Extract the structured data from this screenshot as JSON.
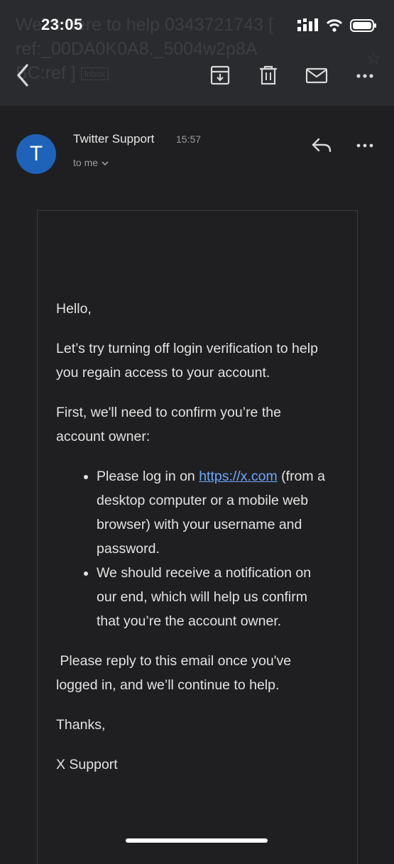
{
  "status_bar": {
    "time": "23:05"
  },
  "header": {
    "subject": "We're here to help 0343721743 [ ref:_00DA0K0A8._5004w2p8A",
    "subject_line2": "BC:ref ]",
    "label_chip": "Inbox",
    "icons": [
      "back-icon",
      "archive-icon",
      "trash-icon",
      "mail-icon",
      "more-icon"
    ]
  },
  "message": {
    "avatar_letter": "T",
    "sender": "Twitter Support",
    "time": "15:57",
    "recipient": "to me"
  },
  "body": {
    "greeting": "Hello,",
    "para1": "Let’s try turning off login verification to help you regain access to your account.",
    "para2": "First, we'll need to confirm you’re the account owner:",
    "bullet1_prefix": "Please log in on ",
    "bullet1_link": "https://x.com",
    "bullet1_suffix": " (from a desktop computer or a mobile web browser) with your username and password.",
    "bullet2": "We should receive a notification on our end, which will help us confirm that you’re the account owner.",
    "para3": " Please reply to this email once you've logged in, and we’ll continue to help.",
    "closing": "Thanks,",
    "signature": "X Support"
  },
  "colors": {
    "avatar": "#1e63b8",
    "link": "#6ea8ff",
    "background": "#1f1f21"
  }
}
